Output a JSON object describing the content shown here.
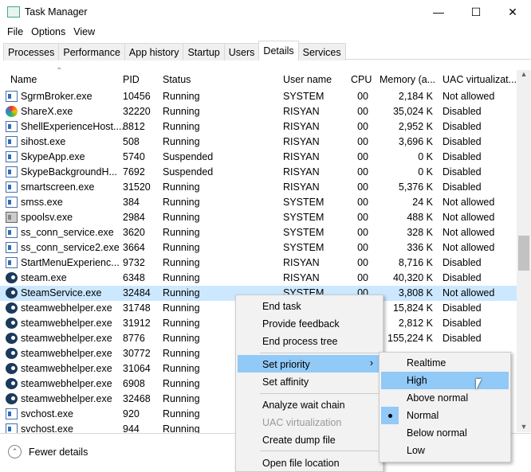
{
  "window": {
    "title": "Task Manager"
  },
  "menu": [
    "File",
    "Options",
    "View"
  ],
  "tabs": [
    "Processes",
    "Performance",
    "App history",
    "Startup",
    "Users",
    "Details",
    "Services"
  ],
  "active_tab": "Details",
  "columns": {
    "name": "Name",
    "pid": "PID",
    "status": "Status",
    "user": "User name",
    "cpu": "CPU",
    "memory": "Memory (a...",
    "uac": "UAC virtualizat..."
  },
  "rows": [
    {
      "name": "SgrmBroker.exe",
      "pid": "10456",
      "status": "Running",
      "user": "SYSTEM",
      "cpu": "00",
      "memory": "2,184 K",
      "uac": "Not allowed",
      "icon": "app"
    },
    {
      "name": "ShareX.exe",
      "pid": "32220",
      "status": "Running",
      "user": "RISYAN",
      "cpu": "00",
      "memory": "35,024 K",
      "uac": "Disabled",
      "icon": "sharex"
    },
    {
      "name": "ShellExperienceHost....",
      "pid": "8812",
      "status": "Running",
      "user": "RISYAN",
      "cpu": "00",
      "memory": "2,952 K",
      "uac": "Disabled",
      "icon": "app"
    },
    {
      "name": "sihost.exe",
      "pid": "508",
      "status": "Running",
      "user": "RISYAN",
      "cpu": "00",
      "memory": "3,696 K",
      "uac": "Disabled",
      "icon": "app"
    },
    {
      "name": "SkypeApp.exe",
      "pid": "5740",
      "status": "Suspended",
      "user": "RISYAN",
      "cpu": "00",
      "memory": "0 K",
      "uac": "Disabled",
      "icon": "app"
    },
    {
      "name": "SkypeBackgroundH...",
      "pid": "7692",
      "status": "Suspended",
      "user": "RISYAN",
      "cpu": "00",
      "memory": "0 K",
      "uac": "Disabled",
      "icon": "app"
    },
    {
      "name": "smartscreen.exe",
      "pid": "31520",
      "status": "Running",
      "user": "RISYAN",
      "cpu": "00",
      "memory": "5,376 K",
      "uac": "Disabled",
      "icon": "app"
    },
    {
      "name": "smss.exe",
      "pid": "384",
      "status": "Running",
      "user": "SYSTEM",
      "cpu": "00",
      "memory": "24 K",
      "uac": "Not allowed",
      "icon": "app"
    },
    {
      "name": "spoolsv.exe",
      "pid": "2984",
      "status": "Running",
      "user": "SYSTEM",
      "cpu": "00",
      "memory": "488 K",
      "uac": "Not allowed",
      "icon": "printer"
    },
    {
      "name": "ss_conn_service.exe",
      "pid": "3620",
      "status": "Running",
      "user": "SYSTEM",
      "cpu": "00",
      "memory": "328 K",
      "uac": "Not allowed",
      "icon": "app"
    },
    {
      "name": "ss_conn_service2.exe",
      "pid": "3664",
      "status": "Running",
      "user": "SYSTEM",
      "cpu": "00",
      "memory": "336 K",
      "uac": "Not allowed",
      "icon": "app"
    },
    {
      "name": "StartMenuExperienc...",
      "pid": "9732",
      "status": "Running",
      "user": "RISYAN",
      "cpu": "00",
      "memory": "8,716 K",
      "uac": "Disabled",
      "icon": "app"
    },
    {
      "name": "steam.exe",
      "pid": "6348",
      "status": "Running",
      "user": "RISYAN",
      "cpu": "00",
      "memory": "40,320 K",
      "uac": "Disabled",
      "icon": "steam"
    },
    {
      "name": "SteamService.exe",
      "pid": "32484",
      "status": "Running",
      "user": "SYSTEM",
      "cpu": "00",
      "memory": "3,808 K",
      "uac": "Not allowed",
      "icon": "steam",
      "selected": true
    },
    {
      "name": "steamwebhelper.exe",
      "pid": "31748",
      "status": "Running",
      "user": "",
      "cpu": "",
      "memory": "15,824 K",
      "uac": "Disabled",
      "icon": "steam"
    },
    {
      "name": "steamwebhelper.exe",
      "pid": "31912",
      "status": "Running",
      "user": "",
      "cpu": "",
      "memory": "2,812 K",
      "uac": "Disabled",
      "icon": "steam"
    },
    {
      "name": "steamwebhelper.exe",
      "pid": "8776",
      "status": "Running",
      "user": "",
      "cpu": "",
      "memory": "155,224 K",
      "uac": "Disabled",
      "icon": "steam"
    },
    {
      "name": "steamwebhelper.exe",
      "pid": "30772",
      "status": "Running",
      "user": "",
      "cpu": "",
      "memory": "",
      "uac": "",
      "icon": "steam"
    },
    {
      "name": "steamwebhelper.exe",
      "pid": "31064",
      "status": "Running",
      "user": "",
      "cpu": "",
      "memory": "",
      "uac": "",
      "icon": "steam"
    },
    {
      "name": "steamwebhelper.exe",
      "pid": "6908",
      "status": "Running",
      "user": "",
      "cpu": "",
      "memory": "",
      "uac": "",
      "icon": "steam"
    },
    {
      "name": "steamwebhelper.exe",
      "pid": "32468",
      "status": "Running",
      "user": "",
      "cpu": "",
      "memory": "",
      "uac": "",
      "icon": "steam"
    },
    {
      "name": "svchost.exe",
      "pid": "920",
      "status": "Running",
      "user": "",
      "cpu": "",
      "memory": "",
      "uac": "",
      "icon": "app"
    },
    {
      "name": "svchost.exe",
      "pid": "944",
      "status": "Running",
      "user": "",
      "cpu": "",
      "memory": "",
      "uac": "",
      "icon": "app"
    }
  ],
  "footer": {
    "fewer_details": "Fewer details"
  },
  "context_menu": [
    "End task",
    "Provide feedback",
    "End process tree",
    "Set priority",
    "Set affinity",
    "Analyze wait chain",
    "UAC virtualization",
    "Create dump file",
    "Open file location"
  ],
  "priority_menu": [
    "Realtime",
    "High",
    "Above normal",
    "Normal",
    "Below normal",
    "Low"
  ],
  "priority_current": "Normal",
  "priority_hover": "High"
}
